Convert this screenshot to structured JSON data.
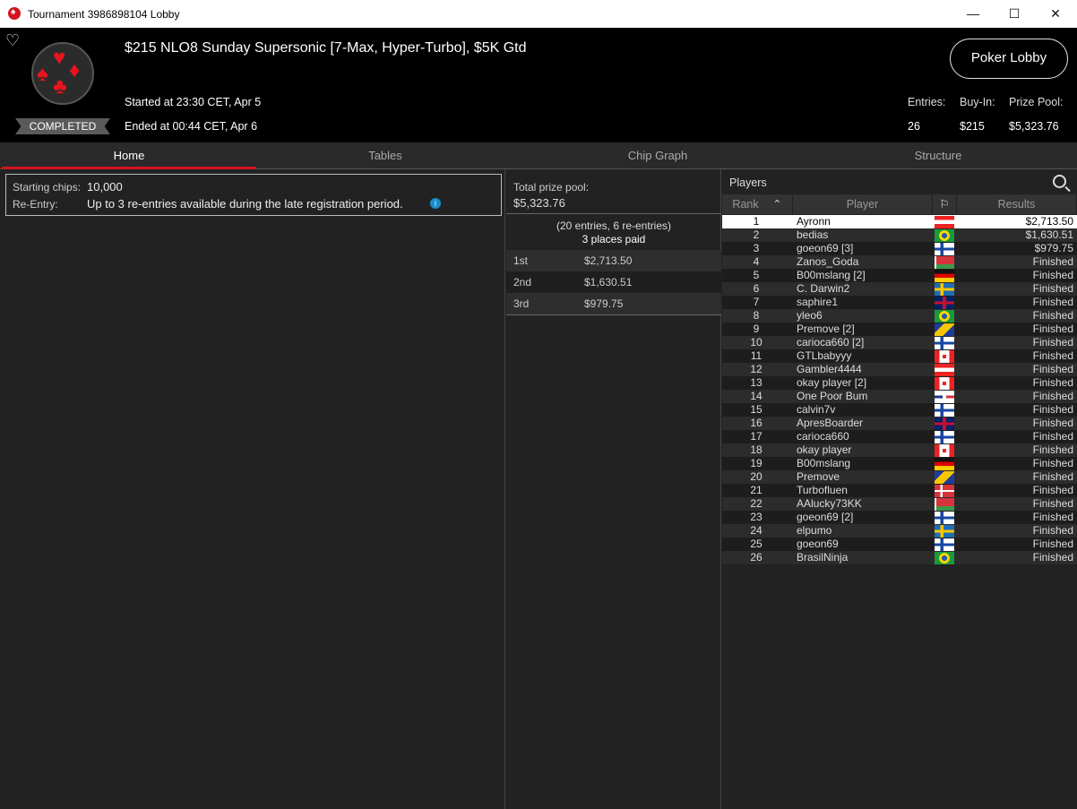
{
  "window": {
    "title": "Tournament 3986898104 Lobby"
  },
  "header": {
    "name": "$215 NLO8 Sunday Supersonic [7-Max, Hyper-Turbo], $5K Gtd",
    "status": "COMPLETED",
    "started": "Started at 23:30 CET, Apr 5",
    "ended": "Ended at 00:44 CET, Apr 6",
    "poker_lobby_label": "Poker Lobby",
    "entries_label": "Entries:",
    "entries": "26",
    "buyin_label": "Buy-In:",
    "buyin": "$215",
    "prizepool_label": "Prize Pool:",
    "prizepool": "$5,323.76"
  },
  "tabs": [
    "Home",
    "Tables",
    "Chip Graph",
    "Structure"
  ],
  "home": {
    "starting_chips_label": "Starting chips:",
    "starting_chips": "10,000",
    "reentry_label": "Re-Entry:",
    "reentry": "Up to 3 re-entries available during the late registration period."
  },
  "prize": {
    "total_label": "Total prize pool:",
    "total": "$5,323.76",
    "entries_note": "(20 entries, 6 re-entries)",
    "places_paid": "3 places paid",
    "payouts": [
      {
        "place": "1st",
        "amount": "$2,713.50"
      },
      {
        "place": "2nd",
        "amount": "$1,630.51"
      },
      {
        "place": "3rd",
        "amount": "$979.75"
      }
    ]
  },
  "players": {
    "title": "Players",
    "columns": {
      "rank": "Rank",
      "player": "Player",
      "results": "Results"
    },
    "rows": [
      {
        "rank": "1",
        "name": "Ayronn",
        "flag": "at",
        "result": "$2,713.50"
      },
      {
        "rank": "2",
        "name": "bedias",
        "flag": "br",
        "result": "$1,630.51"
      },
      {
        "rank": "3",
        "name": "goeon69 [3]",
        "flag": "fi",
        "result": "$979.75"
      },
      {
        "rank": "4",
        "name": "Zanos_Goda",
        "flag": "by",
        "result": "Finished"
      },
      {
        "rank": "5",
        "name": "B00mslang [2]",
        "flag": "de",
        "result": "Finished"
      },
      {
        "rank": "6",
        "name": "C. Darwin2",
        "flag": "se",
        "result": "Finished"
      },
      {
        "rank": "7",
        "name": "saphire1",
        "flag": "gb",
        "result": "Finished"
      },
      {
        "rank": "8",
        "name": "yleo6",
        "flag": "br",
        "result": "Finished"
      },
      {
        "rank": "9",
        "name": "Premove [2]",
        "flag": "ba",
        "result": "Finished"
      },
      {
        "rank": "10",
        "name": "carioca660 [2]",
        "flag": "fi",
        "result": "Finished"
      },
      {
        "rank": "11",
        "name": "GTLbabyyy",
        "flag": "ca",
        "result": "Finished"
      },
      {
        "rank": "12",
        "name": "Gambler4444",
        "flag": "at",
        "result": "Finished"
      },
      {
        "rank": "13",
        "name": "okay player [2]",
        "flag": "ca",
        "result": "Finished"
      },
      {
        "rank": "14",
        "name": "One Poor Bum",
        "flag": "do",
        "result": "Finished"
      },
      {
        "rank": "15",
        "name": "calvin7v",
        "flag": "fi",
        "result": "Finished"
      },
      {
        "rank": "16",
        "name": "ApresBoarder",
        "flag": "gb",
        "result": "Finished"
      },
      {
        "rank": "17",
        "name": "carioca660",
        "flag": "fi",
        "result": "Finished"
      },
      {
        "rank": "18",
        "name": "okay player",
        "flag": "ca",
        "result": "Finished"
      },
      {
        "rank": "19",
        "name": "B00mslang",
        "flag": "de",
        "result": "Finished"
      },
      {
        "rank": "20",
        "name": "Premove",
        "flag": "ba",
        "result": "Finished"
      },
      {
        "rank": "21",
        "name": "Turbofluen",
        "flag": "dk",
        "result": "Finished"
      },
      {
        "rank": "22",
        "name": "AAlucky73KK",
        "flag": "by",
        "result": "Finished"
      },
      {
        "rank": "23",
        "name": "goeon69 [2]",
        "flag": "fi",
        "result": "Finished"
      },
      {
        "rank": "24",
        "name": "elpumo",
        "flag": "se",
        "result": "Finished"
      },
      {
        "rank": "25",
        "name": "goeon69",
        "flag": "fi",
        "result": "Finished"
      },
      {
        "rank": "26",
        "name": "BrasilNinja",
        "flag": "br",
        "result": "Finished"
      }
    ]
  }
}
